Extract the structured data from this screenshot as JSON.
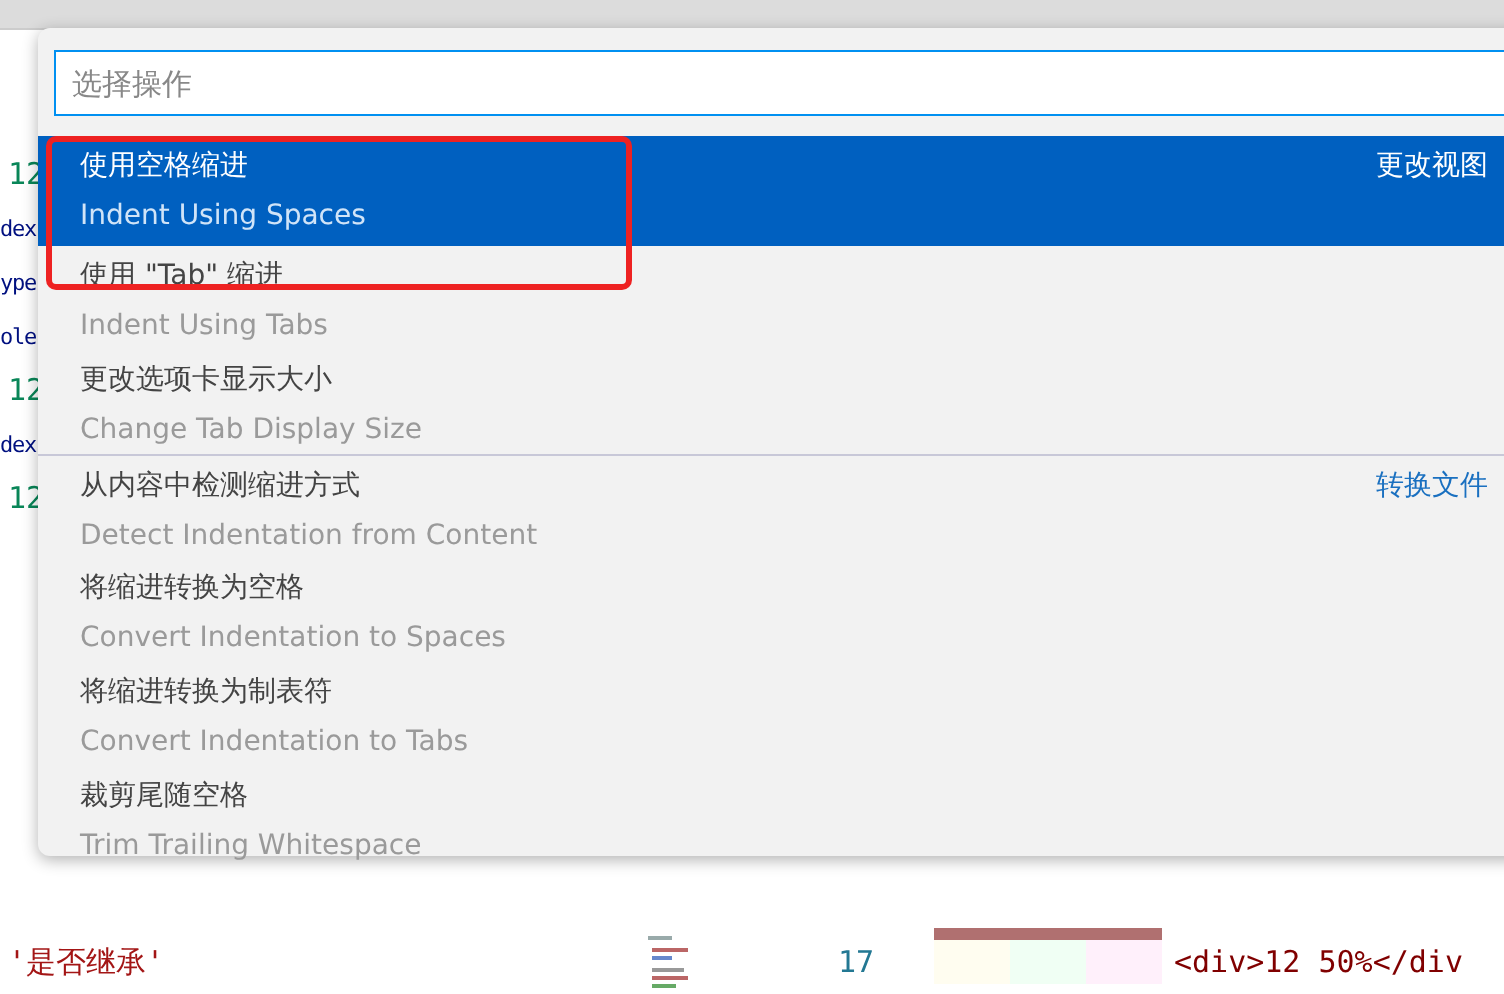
{
  "editor": {
    "left_lines": [
      {
        "text": "12",
        "kind": "number"
      },
      {
        "text": "dex",
        "kind": "code"
      },
      {
        "text": "ype",
        "kind": "code"
      },
      {
        "text": "ole",
        "kind": "code"
      },
      {
        "text": "12",
        "kind": "number"
      },
      {
        "text": "dex",
        "kind": "code"
      },
      {
        "text": "12",
        "kind": "number"
      },
      {
        "text": "'是否继承'",
        "kind": "string"
      }
    ],
    "bottom_line": {
      "number": "17",
      "code": "<div>12  50%</div"
    }
  },
  "quick_pick": {
    "placeholder": "选择操作",
    "items": [
      {
        "label": "使用空格缩进",
        "detail": "Indent Using Spaces",
        "group": "更改视图",
        "selected": true
      },
      {
        "label": "使用 \"Tab\" 缩进",
        "detail": "Indent Using Tabs",
        "selected": false
      },
      {
        "label": "更改选项卡显示大小",
        "detail": "Change Tab Display Size",
        "selected": false
      },
      {
        "label": "从内容中检测缩进方式",
        "detail": "Detect Indentation from Content",
        "group": "转换文件",
        "selected": false
      },
      {
        "label": "将缩进转换为空格",
        "detail": "Convert Indentation to Spaces",
        "selected": false
      },
      {
        "label": "将缩进转换为制表符",
        "detail": "Convert Indentation to Tabs",
        "selected": false
      },
      {
        "label": "裁剪尾随空格",
        "detail": "Trim Trailing Whitespace",
        "selected": false
      }
    ]
  }
}
